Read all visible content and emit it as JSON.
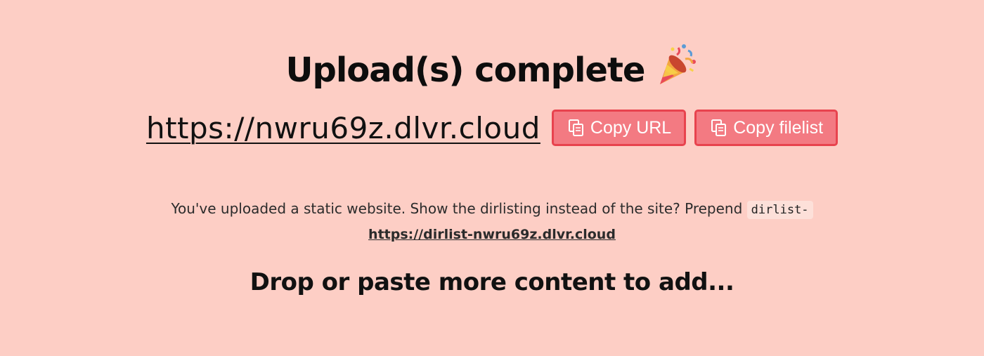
{
  "header": {
    "title": "Upload(s) complete",
    "title_icon": "party-popper-icon"
  },
  "share": {
    "url": "https://nwru69z.dlvr.cloud",
    "copy_url_label": "Copy URL",
    "copy_filelist_label": "Copy filelist",
    "copy_icon": "copy-icon"
  },
  "notice": {
    "text": "You've uploaded a static website. Show the dirlisting instead of the site? Prepend",
    "code": "dirlist-",
    "dirlist_url": "https://dirlist-nwru69z.dlvr.cloud"
  },
  "dropzone": {
    "text": "Drop or paste more content to add..."
  },
  "colors": {
    "background": "#fdcec5",
    "button_fill": "#f37a82",
    "button_border": "#e8434e",
    "text": "#111111"
  }
}
